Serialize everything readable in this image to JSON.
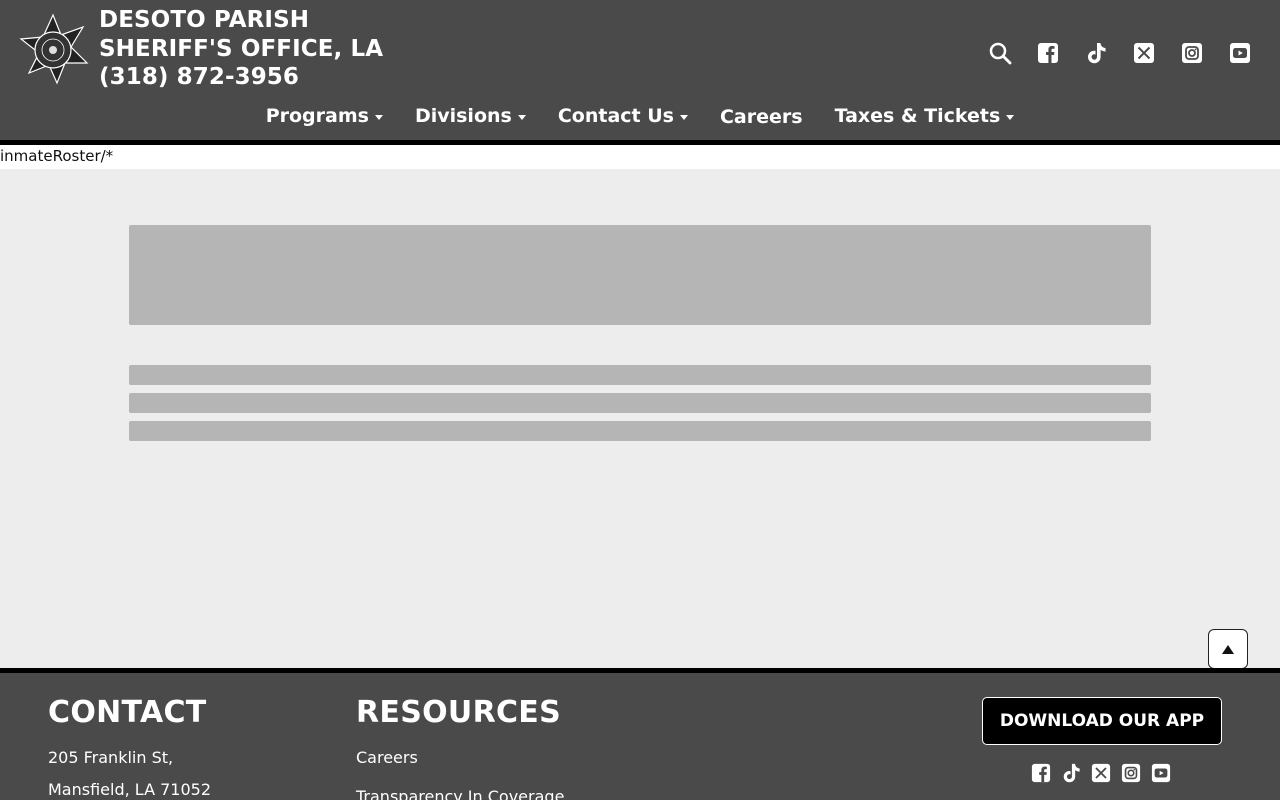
{
  "header": {
    "brand_line1": "DESOTO PARISH",
    "brand_line2": "SHERIFF'S OFFICE, LA",
    "phone": "(318) 872-3956",
    "icons": [
      "search-icon",
      "facebook-icon",
      "tiktok-icon",
      "x-icon",
      "instagram-icon",
      "youtube-icon"
    ]
  },
  "nav": {
    "items": [
      {
        "label": "Programs",
        "has_dropdown": true
      },
      {
        "label": "Divisions",
        "has_dropdown": true
      },
      {
        "label": "Contact Us",
        "has_dropdown": true
      },
      {
        "label": "Careers",
        "has_dropdown": false
      },
      {
        "label": "Taxes & Tickets",
        "has_dropdown": true
      }
    ]
  },
  "page": {
    "path_text": "inmateRoster/*"
  },
  "footer": {
    "contact_heading": "CONTACT",
    "address_line1": "205 Franklin St,",
    "address_line2": "Mansfield, LA 71052",
    "resources_heading": "RESOURCES",
    "resources": [
      "Careers",
      "Transparency In Coverage"
    ],
    "app_button": "DOWNLOAD OUR APP",
    "icons": [
      "facebook-icon",
      "tiktok-icon",
      "x-icon",
      "instagram-icon",
      "youtube-icon"
    ]
  },
  "colors": {
    "header_bg": "#4a4a4a",
    "border": "#000000",
    "page_bg": "#ededed",
    "skeleton": "#b5b5b5"
  }
}
